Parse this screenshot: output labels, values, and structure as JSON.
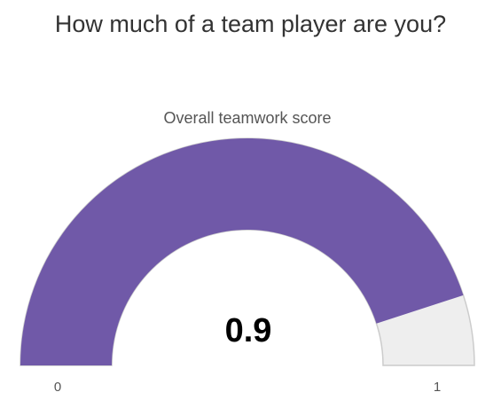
{
  "chart_data": {
    "type": "gauge",
    "title": "How much of a team player are you?",
    "subtitle": "Overall teamwork score",
    "value": 0.9,
    "value_label": "0.9",
    "min": 0,
    "max": 1,
    "min_label": "0",
    "max_label": "1",
    "colors": {
      "fill": "#7059a8",
      "background": "#eeeeee",
      "border": "#cccccc"
    }
  }
}
